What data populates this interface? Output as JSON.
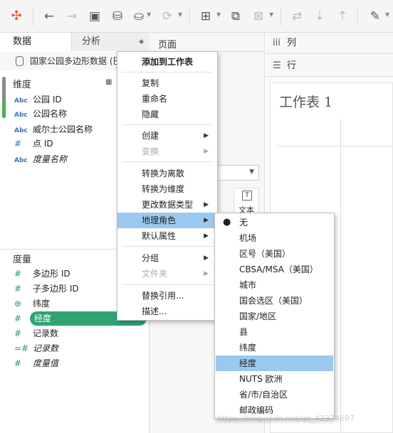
{
  "toolbar": {
    "icons": [
      "tableau-logo-icon",
      "undo-icon",
      "redo-icon",
      "save-icon",
      "new-datasource-icon",
      "datasource-icon",
      "refresh-icon",
      "new-worksheet-icon",
      "duplicate-icon",
      "clear-icon",
      "swap-icon",
      "sort-asc-icon",
      "sort-desc-icon",
      "highlight-icon"
    ]
  },
  "left": {
    "tabs": {
      "data": "数据",
      "analysis": "分析"
    },
    "source": "国家公园多边形数据 (巴",
    "dimensions_title": "维度",
    "dimensions": [
      {
        "type": "Abc",
        "name": "公园 ID",
        "italic": false
      },
      {
        "type": "Abc",
        "name": "公园名称",
        "italic": false
      },
      {
        "type": "Abc",
        "name": "威尔士公园名称",
        "italic": false
      },
      {
        "type": "#",
        "name": "点 ID",
        "italic": false
      },
      {
        "type": "Abc",
        "name": "度量名称",
        "italic": true
      }
    ],
    "measures_title": "度量",
    "measures": [
      {
        "type": "#",
        "name": "多边形 ID",
        "italic": false
      },
      {
        "type": "#",
        "name": "子多边形 ID",
        "italic": false
      },
      {
        "type": "globe",
        "name": "纬度",
        "italic": false
      },
      {
        "type": "#",
        "name": "经度",
        "italic": false,
        "selected": true
      },
      {
        "type": "#",
        "name": "记录数",
        "italic": false
      },
      {
        "type": "=#",
        "name": "记录数",
        "italic": true
      },
      {
        "type": "#",
        "name": "度量值",
        "italic": true
      }
    ]
  },
  "mid": {
    "pages_title": "页面",
    "marks_dropdown_caret": "▼",
    "text_label": "文本",
    "text_icon": "T"
  },
  "right": {
    "columns_label": "列",
    "rows_label": "行",
    "sheet_title": "工作表 1"
  },
  "context_menu": {
    "items": [
      {
        "label": "添加到工作表",
        "bold": true
      },
      {
        "sep": true
      },
      {
        "label": "复制"
      },
      {
        "label": "重命名"
      },
      {
        "label": "隐藏"
      },
      {
        "sep": true
      },
      {
        "label": "创建",
        "submenu": true
      },
      {
        "label": "变换",
        "submenu": true,
        "disabled": true
      },
      {
        "sep": true
      },
      {
        "label": "转换为离散"
      },
      {
        "label": "转换为维度"
      },
      {
        "label": "更改数据类型",
        "submenu": true
      },
      {
        "label": "地理角色",
        "submenu": true,
        "highlighted": true
      },
      {
        "label": "默认属性",
        "submenu": true
      },
      {
        "sep": true
      },
      {
        "label": "分组",
        "submenu": true
      },
      {
        "label": "文件夹",
        "submenu": true,
        "disabled": true
      },
      {
        "sep": true
      },
      {
        "label": "替换引用..."
      },
      {
        "label": "描述..."
      }
    ]
  },
  "geo_submenu": {
    "items": [
      {
        "label": "无",
        "checked": true
      },
      {
        "label": "机场"
      },
      {
        "label": "区号（美国）"
      },
      {
        "label": "CBSA/MSA（美国）"
      },
      {
        "label": "城市"
      },
      {
        "label": "国会选区（美国）"
      },
      {
        "label": "国家/地区"
      },
      {
        "label": "县"
      },
      {
        "label": "纬度"
      },
      {
        "label": "经度",
        "highlighted": true
      },
      {
        "label": "NUTS 欧洲"
      },
      {
        "label": "省/市/自治区"
      },
      {
        "label": "邮政编码"
      }
    ]
  },
  "watermark": "https://blog.csdn.net/qq_42374697",
  "colors": {
    "accent": "#30a375",
    "menu_highlight": "#9bc8ef",
    "type_blue": "#3a73b8"
  }
}
